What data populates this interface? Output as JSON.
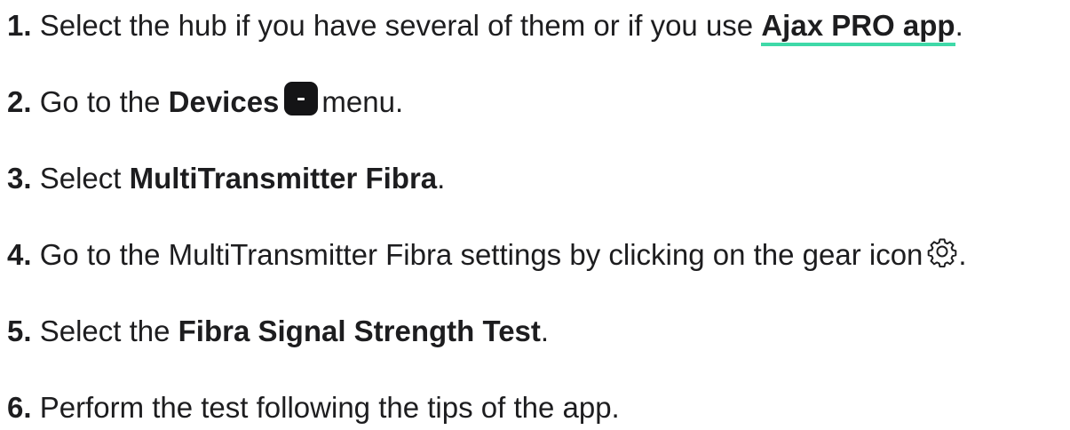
{
  "steps": [
    {
      "number": "1.",
      "text_before": "Select the hub if you have several of them or if you use",
      "link_text": "Ajax PRO app",
      "text_after": "."
    },
    {
      "number": "2.",
      "text_before": "Go to the",
      "bold": "Devices",
      "icon": "devices-icon",
      "text_after": "menu."
    },
    {
      "number": "3.",
      "text_before": "Select",
      "bold": "MultiTransmitter Fibra",
      "text_after": "."
    },
    {
      "number": "4.",
      "text_before": "Go to the MultiTransmitter Fibra settings by clicking on the gear icon",
      "icon": "gear-icon",
      "text_after": "."
    },
    {
      "number": "5.",
      "text_before": "Select the",
      "bold": "Fibra Signal Strength Test",
      "text_after": "."
    },
    {
      "number": "6.",
      "text_before": "Perform the test following the tips of the app."
    }
  ],
  "colors": {
    "text": "#1d1d1f",
    "link_underline": "#3fd9a8",
    "icon_bg": "#141416"
  }
}
